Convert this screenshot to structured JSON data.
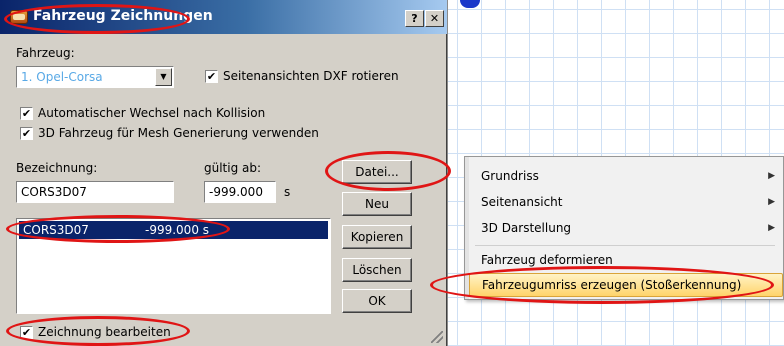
{
  "dialog": {
    "title": "Fahrzeug Zeichnungen",
    "help_label": "?",
    "close_label": "✕",
    "vehicle_label": "Fahrzeug:",
    "vehicle_value": "1. Opel-Corsa",
    "rotate_dxf_label": "Seitenansichten DXF rotieren",
    "rotate_dxf_checked": true,
    "auto_switch_label": "Automatischer Wechsel nach Kollision",
    "auto_switch_checked": true,
    "mesh_label": "3D Fahrzeug für Mesh Generierung verwenden",
    "mesh_checked": true,
    "name_label": "Bezeichnung:",
    "name_value": "CORS3D07",
    "valid_label": "gültig ab:",
    "valid_value": "-999.000",
    "valid_unit": "s",
    "list": [
      {
        "name": "CORS3D07",
        "value": "-999.000 s",
        "selected": true
      }
    ],
    "buttons": {
      "file": "Datei...",
      "new": "Neu",
      "copy": "Kopieren",
      "delete": "Löschen",
      "ok": "OK"
    },
    "edit_drawing_label": "Zeichnung bearbeiten",
    "edit_drawing_checked": true
  },
  "context_menu": {
    "items": [
      {
        "label": "Grundriss",
        "submenu": true
      },
      {
        "label": "Seitenansicht",
        "submenu": true
      },
      {
        "label": "3D Darstellung",
        "submenu": true
      },
      {
        "label": "Fahrzeug deformieren",
        "submenu": false
      },
      {
        "label": "Fahrzeugumriss erzeugen (Stoßerkennung)",
        "submenu": false,
        "highlighted": true
      }
    ]
  },
  "icons": {
    "title_icon": "car-icon",
    "combo_arrow": "chevron-down-icon",
    "submenu_arrow": "chevron-right-icon"
  },
  "colors": {
    "annotation": "#e01515",
    "selection": "#0a246a",
    "menu_highlight": "#ffd46b"
  }
}
